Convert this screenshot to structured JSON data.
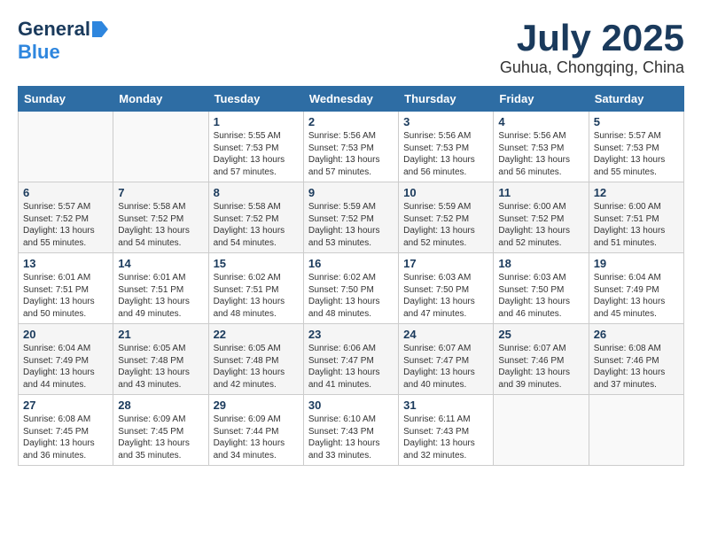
{
  "header": {
    "logo_general": "General",
    "logo_blue": "Blue",
    "month_title": "July 2025",
    "location": "Guhua, Chongqing, China"
  },
  "days_of_week": [
    "Sunday",
    "Monday",
    "Tuesday",
    "Wednesday",
    "Thursday",
    "Friday",
    "Saturday"
  ],
  "weeks": [
    [
      {
        "day": "",
        "content": ""
      },
      {
        "day": "",
        "content": ""
      },
      {
        "day": "1",
        "content": "Sunrise: 5:55 AM\nSunset: 7:53 PM\nDaylight: 13 hours and 57 minutes."
      },
      {
        "day": "2",
        "content": "Sunrise: 5:56 AM\nSunset: 7:53 PM\nDaylight: 13 hours and 57 minutes."
      },
      {
        "day": "3",
        "content": "Sunrise: 5:56 AM\nSunset: 7:53 PM\nDaylight: 13 hours and 56 minutes."
      },
      {
        "day": "4",
        "content": "Sunrise: 5:56 AM\nSunset: 7:53 PM\nDaylight: 13 hours and 56 minutes."
      },
      {
        "day": "5",
        "content": "Sunrise: 5:57 AM\nSunset: 7:53 PM\nDaylight: 13 hours and 55 minutes."
      }
    ],
    [
      {
        "day": "6",
        "content": "Sunrise: 5:57 AM\nSunset: 7:52 PM\nDaylight: 13 hours and 55 minutes."
      },
      {
        "day": "7",
        "content": "Sunrise: 5:58 AM\nSunset: 7:52 PM\nDaylight: 13 hours and 54 minutes."
      },
      {
        "day": "8",
        "content": "Sunrise: 5:58 AM\nSunset: 7:52 PM\nDaylight: 13 hours and 54 minutes."
      },
      {
        "day": "9",
        "content": "Sunrise: 5:59 AM\nSunset: 7:52 PM\nDaylight: 13 hours and 53 minutes."
      },
      {
        "day": "10",
        "content": "Sunrise: 5:59 AM\nSunset: 7:52 PM\nDaylight: 13 hours and 52 minutes."
      },
      {
        "day": "11",
        "content": "Sunrise: 6:00 AM\nSunset: 7:52 PM\nDaylight: 13 hours and 52 minutes."
      },
      {
        "day": "12",
        "content": "Sunrise: 6:00 AM\nSunset: 7:51 PM\nDaylight: 13 hours and 51 minutes."
      }
    ],
    [
      {
        "day": "13",
        "content": "Sunrise: 6:01 AM\nSunset: 7:51 PM\nDaylight: 13 hours and 50 minutes."
      },
      {
        "day": "14",
        "content": "Sunrise: 6:01 AM\nSunset: 7:51 PM\nDaylight: 13 hours and 49 minutes."
      },
      {
        "day": "15",
        "content": "Sunrise: 6:02 AM\nSunset: 7:51 PM\nDaylight: 13 hours and 48 minutes."
      },
      {
        "day": "16",
        "content": "Sunrise: 6:02 AM\nSunset: 7:50 PM\nDaylight: 13 hours and 48 minutes."
      },
      {
        "day": "17",
        "content": "Sunrise: 6:03 AM\nSunset: 7:50 PM\nDaylight: 13 hours and 47 minutes."
      },
      {
        "day": "18",
        "content": "Sunrise: 6:03 AM\nSunset: 7:50 PM\nDaylight: 13 hours and 46 minutes."
      },
      {
        "day": "19",
        "content": "Sunrise: 6:04 AM\nSunset: 7:49 PM\nDaylight: 13 hours and 45 minutes."
      }
    ],
    [
      {
        "day": "20",
        "content": "Sunrise: 6:04 AM\nSunset: 7:49 PM\nDaylight: 13 hours and 44 minutes."
      },
      {
        "day": "21",
        "content": "Sunrise: 6:05 AM\nSunset: 7:48 PM\nDaylight: 13 hours and 43 minutes."
      },
      {
        "day": "22",
        "content": "Sunrise: 6:05 AM\nSunset: 7:48 PM\nDaylight: 13 hours and 42 minutes."
      },
      {
        "day": "23",
        "content": "Sunrise: 6:06 AM\nSunset: 7:47 PM\nDaylight: 13 hours and 41 minutes."
      },
      {
        "day": "24",
        "content": "Sunrise: 6:07 AM\nSunset: 7:47 PM\nDaylight: 13 hours and 40 minutes."
      },
      {
        "day": "25",
        "content": "Sunrise: 6:07 AM\nSunset: 7:46 PM\nDaylight: 13 hours and 39 minutes."
      },
      {
        "day": "26",
        "content": "Sunrise: 6:08 AM\nSunset: 7:46 PM\nDaylight: 13 hours and 37 minutes."
      }
    ],
    [
      {
        "day": "27",
        "content": "Sunrise: 6:08 AM\nSunset: 7:45 PM\nDaylight: 13 hours and 36 minutes."
      },
      {
        "day": "28",
        "content": "Sunrise: 6:09 AM\nSunset: 7:45 PM\nDaylight: 13 hours and 35 minutes."
      },
      {
        "day": "29",
        "content": "Sunrise: 6:09 AM\nSunset: 7:44 PM\nDaylight: 13 hours and 34 minutes."
      },
      {
        "day": "30",
        "content": "Sunrise: 6:10 AM\nSunset: 7:43 PM\nDaylight: 13 hours and 33 minutes."
      },
      {
        "day": "31",
        "content": "Sunrise: 6:11 AM\nSunset: 7:43 PM\nDaylight: 13 hours and 32 minutes."
      },
      {
        "day": "",
        "content": ""
      },
      {
        "day": "",
        "content": ""
      }
    ]
  ]
}
